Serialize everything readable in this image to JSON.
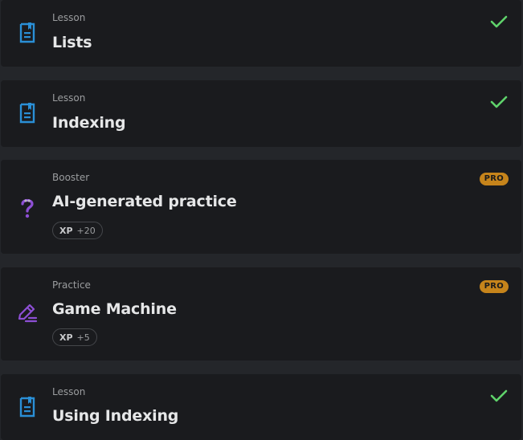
{
  "colors": {
    "lesson_icon": "#2a8fd6",
    "booster_icon": "#8d4fd4",
    "practice_icon": "#8d4fd4",
    "check": "#5fd36b",
    "pro_badge": "#c6841b",
    "card_bg": "#1a1b1e",
    "page_bg": "#24262a"
  },
  "items": [
    {
      "kind": "Lesson",
      "title": "Lists",
      "icon": "lesson-doc-icon",
      "status": "completed"
    },
    {
      "kind": "Lesson",
      "title": "Indexing",
      "icon": "lesson-doc-icon",
      "status": "completed"
    },
    {
      "kind": "Booster",
      "title": "AI-generated practice",
      "icon": "question-mark-icon",
      "badge": "PRO",
      "xp_label": "XP",
      "xp_value": "+20"
    },
    {
      "kind": "Practice",
      "title": "Game Machine",
      "icon": "pencil-icon",
      "badge": "PRO",
      "xp_label": "XP",
      "xp_value": "+5"
    },
    {
      "kind": "Lesson",
      "title": "Using Indexing",
      "icon": "lesson-doc-icon",
      "status": "completed"
    }
  ]
}
